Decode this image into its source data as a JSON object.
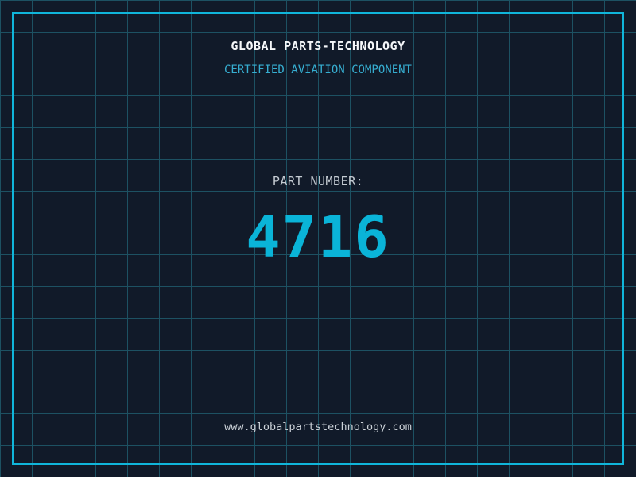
{
  "theme": {
    "background": "#111a29",
    "grid_line": "#1d5162",
    "frame": "#10b6db",
    "title_color": "#f5f7f9",
    "subtitle_color": "#36aed1",
    "label_color": "#c5ccd3",
    "number_color": "#0ab4d8",
    "url_color": "#ccd2d8"
  },
  "header": {
    "title": "GLOBAL PARTS-TECHNOLOGY",
    "subtitle": "CERTIFIED AVIATION COMPONENT"
  },
  "part": {
    "label": "PART NUMBER:",
    "number": "4716"
  },
  "footer": {
    "url": "www.globalpartstechnology.com"
  }
}
